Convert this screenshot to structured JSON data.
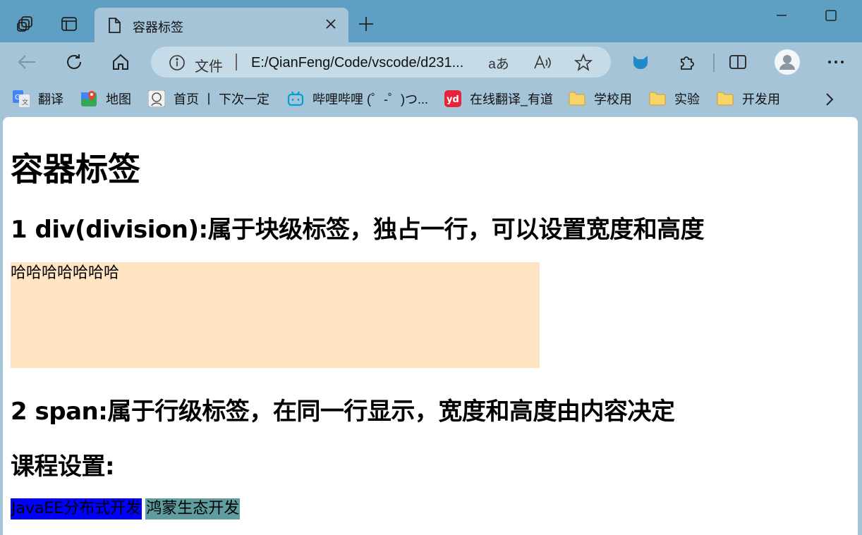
{
  "tab": {
    "title": "容器标签"
  },
  "address": {
    "scheme": "文件",
    "url": "E:/QianFeng/Code/vscode/d231..."
  },
  "favorites": [
    {
      "label": "翻译",
      "icon": "google-translate-icon"
    },
    {
      "label": "地图",
      "icon": "maps-icon"
    },
    {
      "label": "首页 丨 下次一定",
      "icon": "avatar-icon"
    },
    {
      "label": "哔哩哔哩 (゜-゜)つ...",
      "icon": "bilibili-icon"
    },
    {
      "label": "在线翻译_有道",
      "icon": "youdao-icon"
    },
    {
      "label": "学校用",
      "icon": "folder-icon"
    },
    {
      "label": "实验",
      "icon": "folder-icon"
    },
    {
      "label": "开发用",
      "icon": "folder-icon"
    }
  ],
  "page": {
    "h1": "容器标签",
    "h2_div": "1 div(division):属于块级标签，独占一行，可以设置宽度和高度",
    "div_text": "哈哈哈哈哈哈哈",
    "h2_span": "2 span:属于行级标签，在同一行显示，宽度和高度由内容决定",
    "h2_course": "课程设置:",
    "span_a": "JavaEE分布式开发",
    "span_b": "鸿蒙生态开发"
  },
  "colors": {
    "tabstrip": "#5f9fc4",
    "chrome": "#a5c4d8",
    "div_bg": "#ffe4c4",
    "span_a_bg": "#0000ff",
    "span_b_bg": "#5f9ea0"
  }
}
